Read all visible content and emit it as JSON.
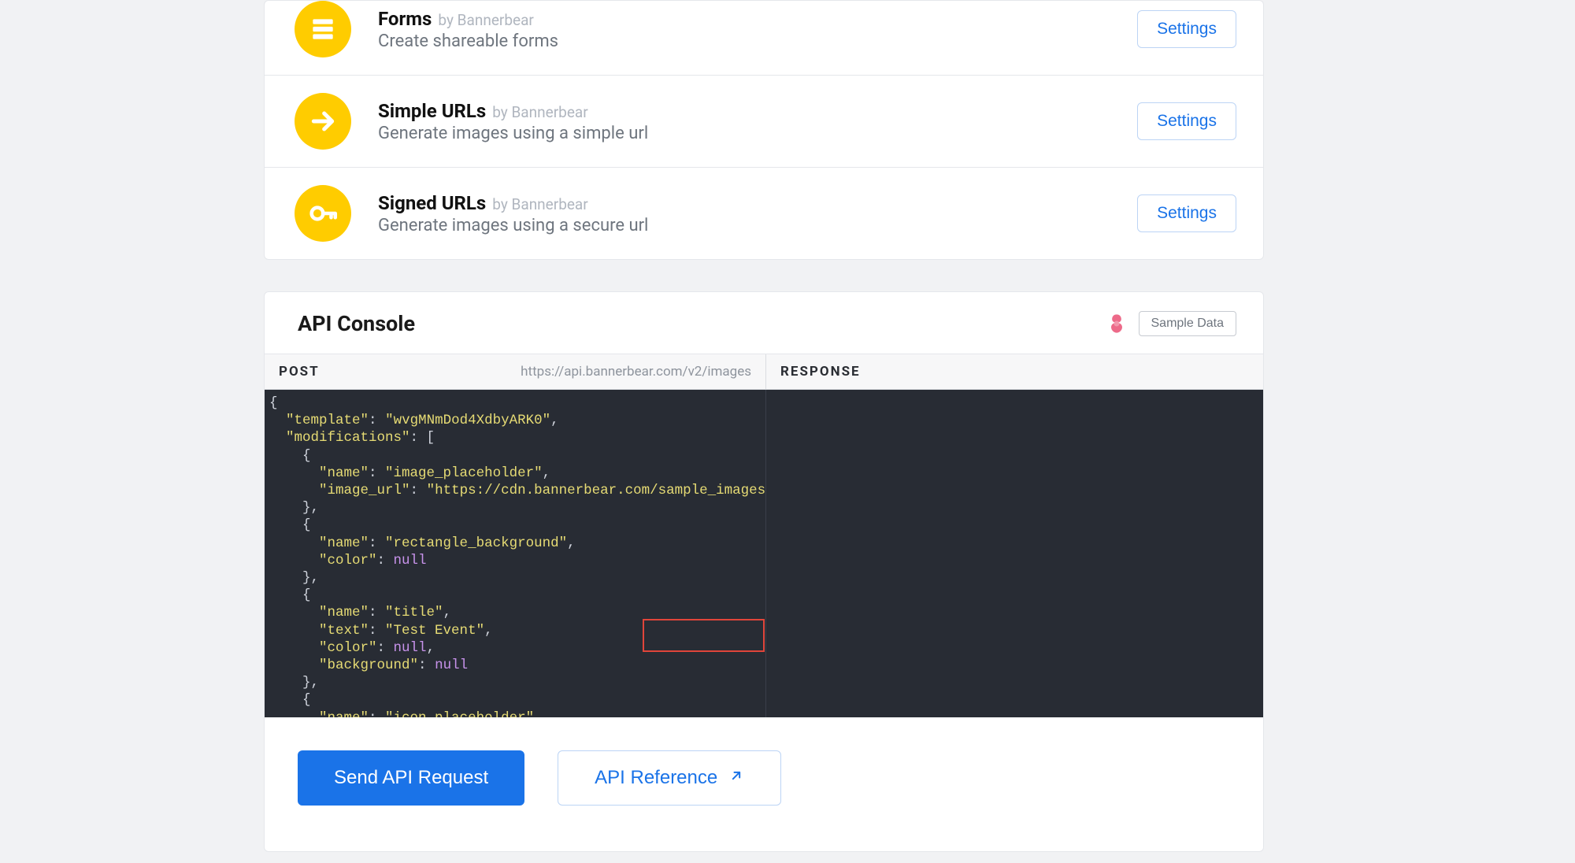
{
  "integrations": [
    {
      "title": "Forms",
      "by": "by Bannerbear",
      "desc": "Create shareable forms",
      "settings": "Settings",
      "icon": "forms"
    },
    {
      "title": "Simple URLs",
      "by": "by Bannerbear",
      "desc": "Generate images using a simple url",
      "settings": "Settings",
      "icon": "arrow"
    },
    {
      "title": "Signed URLs",
      "by": "by Bannerbear",
      "desc": "Generate images using a secure url",
      "settings": "Settings",
      "icon": "key"
    }
  ],
  "api": {
    "title": "API Console",
    "sample_data": "Sample Data",
    "post_label": "POST",
    "post_url": "https://api.bannerbear.com/v2/images",
    "response_label": "RESPONSE",
    "send_button": "Send API Request",
    "ref_button": "API Reference",
    "code": {
      "l1": "{",
      "l2a": "  ",
      "l2k": "\"template\"",
      "l2c": ": ",
      "l2v": "\"wvgMNmDod4XdbyARK0\"",
      "l2e": ",",
      "l3a": "  ",
      "l3k": "\"modifications\"",
      "l3c": ": [",
      "l4": "    {",
      "l5a": "      ",
      "l5k": "\"name\"",
      "l5c": ": ",
      "l5v": "\"image_placeholder\"",
      "l5e": ",",
      "l6a": "      ",
      "l6k": "\"image_url\"",
      "l6c": ": ",
      "l6v": "\"https://cdn.bannerbear.com/sample_images/w",
      "l7": "    },",
      "l8": "    {",
      "l9a": "      ",
      "l9k": "\"name\"",
      "l9c": ": ",
      "l9v": "\"rectangle_background\"",
      "l9e": ",",
      "l10a": "      ",
      "l10k": "\"color\"",
      "l10c": ": ",
      "l10v": "null",
      "l11": "    },",
      "l12": "    {",
      "l13a": "      ",
      "l13k": "\"name\"",
      "l13c": ": ",
      "l13v": "\"title\"",
      "l13e": ",",
      "l14a": "      ",
      "l14k": "\"text\"",
      "l14c": ": ",
      "l14v": "\"Test Event\"",
      "l14e": ",",
      "l15a": "      ",
      "l15k": "\"color\"",
      "l15c": ": ",
      "l15v": "null",
      "l15e": ",",
      "l16a": "      ",
      "l16k": "\"background\"",
      "l16c": ": ",
      "l16v": "null",
      "l17": "    },",
      "l18": "    {",
      "l19a": "      ",
      "l19k": "\"name\"",
      "l19c": ": ",
      "l19v": "\"icon_placeholder\"",
      "l19e": ","
    }
  }
}
